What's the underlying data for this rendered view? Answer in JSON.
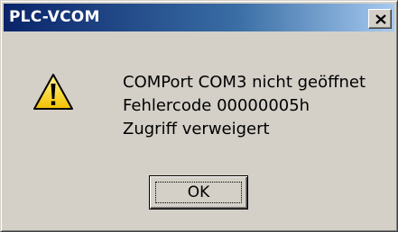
{
  "window": {
    "title": "PLC-VCOM",
    "close_symbol": "×"
  },
  "message": {
    "icon": "warning-icon",
    "lines": [
      "COMPort COM3 nicht geöffnet",
      "Fehlercode 00000005h",
      "Zugriff verweigert"
    ]
  },
  "buttons": {
    "ok_label": "OK"
  },
  "colors": {
    "titlebar_start": "#0a246a",
    "titlebar_end": "#a6caf0",
    "dialog_face": "#d4d0c8",
    "warning_yellow": "#f7d730"
  }
}
